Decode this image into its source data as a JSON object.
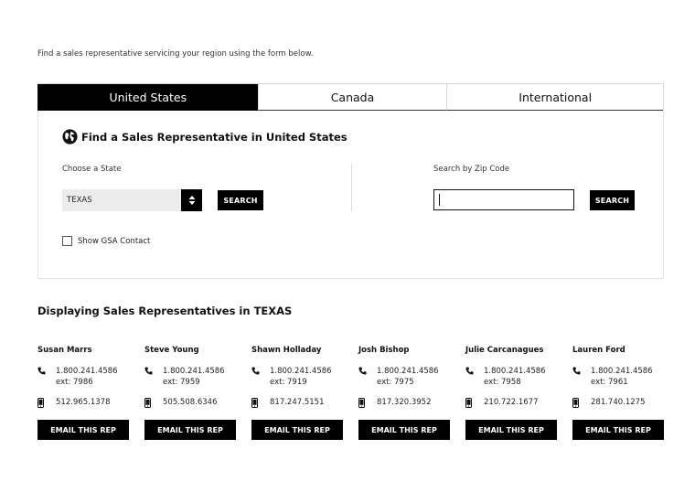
{
  "intro": "Find a sales representative servicing your region using the form below.",
  "tabs": [
    {
      "label": "United States",
      "active": true
    },
    {
      "label": "Canada",
      "active": false
    },
    {
      "label": "International",
      "active": false
    }
  ],
  "panel": {
    "title": "Find a Sales Representative in United States",
    "state_label": "Choose a State",
    "state_value": "TEXAS",
    "state_search": "SEARCH",
    "zip_label": "Search by Zip Code",
    "zip_value": "",
    "zip_search": "SEARCH",
    "gsa_label": "Show GSA Contact"
  },
  "results_title": "Displaying Sales Representatives in TEXAS",
  "reps": [
    {
      "name": "Susan Marrs",
      "phone": "1.800.241.4586",
      "ext": "ext: 7986",
      "mobile": "512.965.1378",
      "button": "EMAIL THIS REP"
    },
    {
      "name": "Steve Young",
      "phone": "1.800.241.4586",
      "ext": "ext: 7959",
      "mobile": "505.508.6346",
      "button": "EMAIL THIS REP"
    },
    {
      "name": "Shawn Holladay",
      "phone": "1.800.241.4586",
      "ext": "ext: 7919",
      "mobile": "817.247.5151",
      "button": "EMAIL THIS REP"
    },
    {
      "name": "Josh Bishop",
      "phone": "1.800.241.4586",
      "ext": "ext: 7975",
      "mobile": "817.320.3952",
      "button": "EMAIL THIS REP"
    },
    {
      "name": "Julie Carcanagues",
      "phone": "1.800.241.4586",
      "ext": "ext: 7958",
      "mobile": "210.722.1677",
      "button": "EMAIL THIS REP"
    },
    {
      "name": "Lauren Ford",
      "phone": "1.800.241.4586",
      "ext": "ext: 7961",
      "mobile": "281.740.1275",
      "button": "EMAIL THIS REP"
    }
  ],
  "icons": {
    "globe": "globe-icon",
    "phone": "phone-icon",
    "mobile": "mobile-icon",
    "select": "select-arrows-icon"
  }
}
